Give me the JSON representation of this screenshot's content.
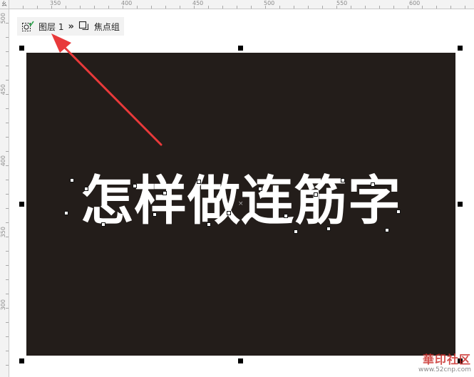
{
  "ruler": {
    "unit": "幺",
    "x_labels": [
      "350",
      "400",
      "450",
      "500",
      "550",
      "600"
    ],
    "y_labels": [
      "500",
      "450",
      "400",
      "350",
      "300"
    ]
  },
  "breadcrumb": {
    "layer_label": "图层 1",
    "separator": "»",
    "group_label": "焦点组"
  },
  "canvas": {
    "main_text": "怎样做连筋字",
    "center_mark": "×",
    "background_color": "#231d1a",
    "text_color": "#ffffff"
  },
  "annotation": {
    "arrow_color": "#e8393a"
  },
  "watermark": {
    "logo_text": "華印社区",
    "url": "www.52cnp.com"
  }
}
